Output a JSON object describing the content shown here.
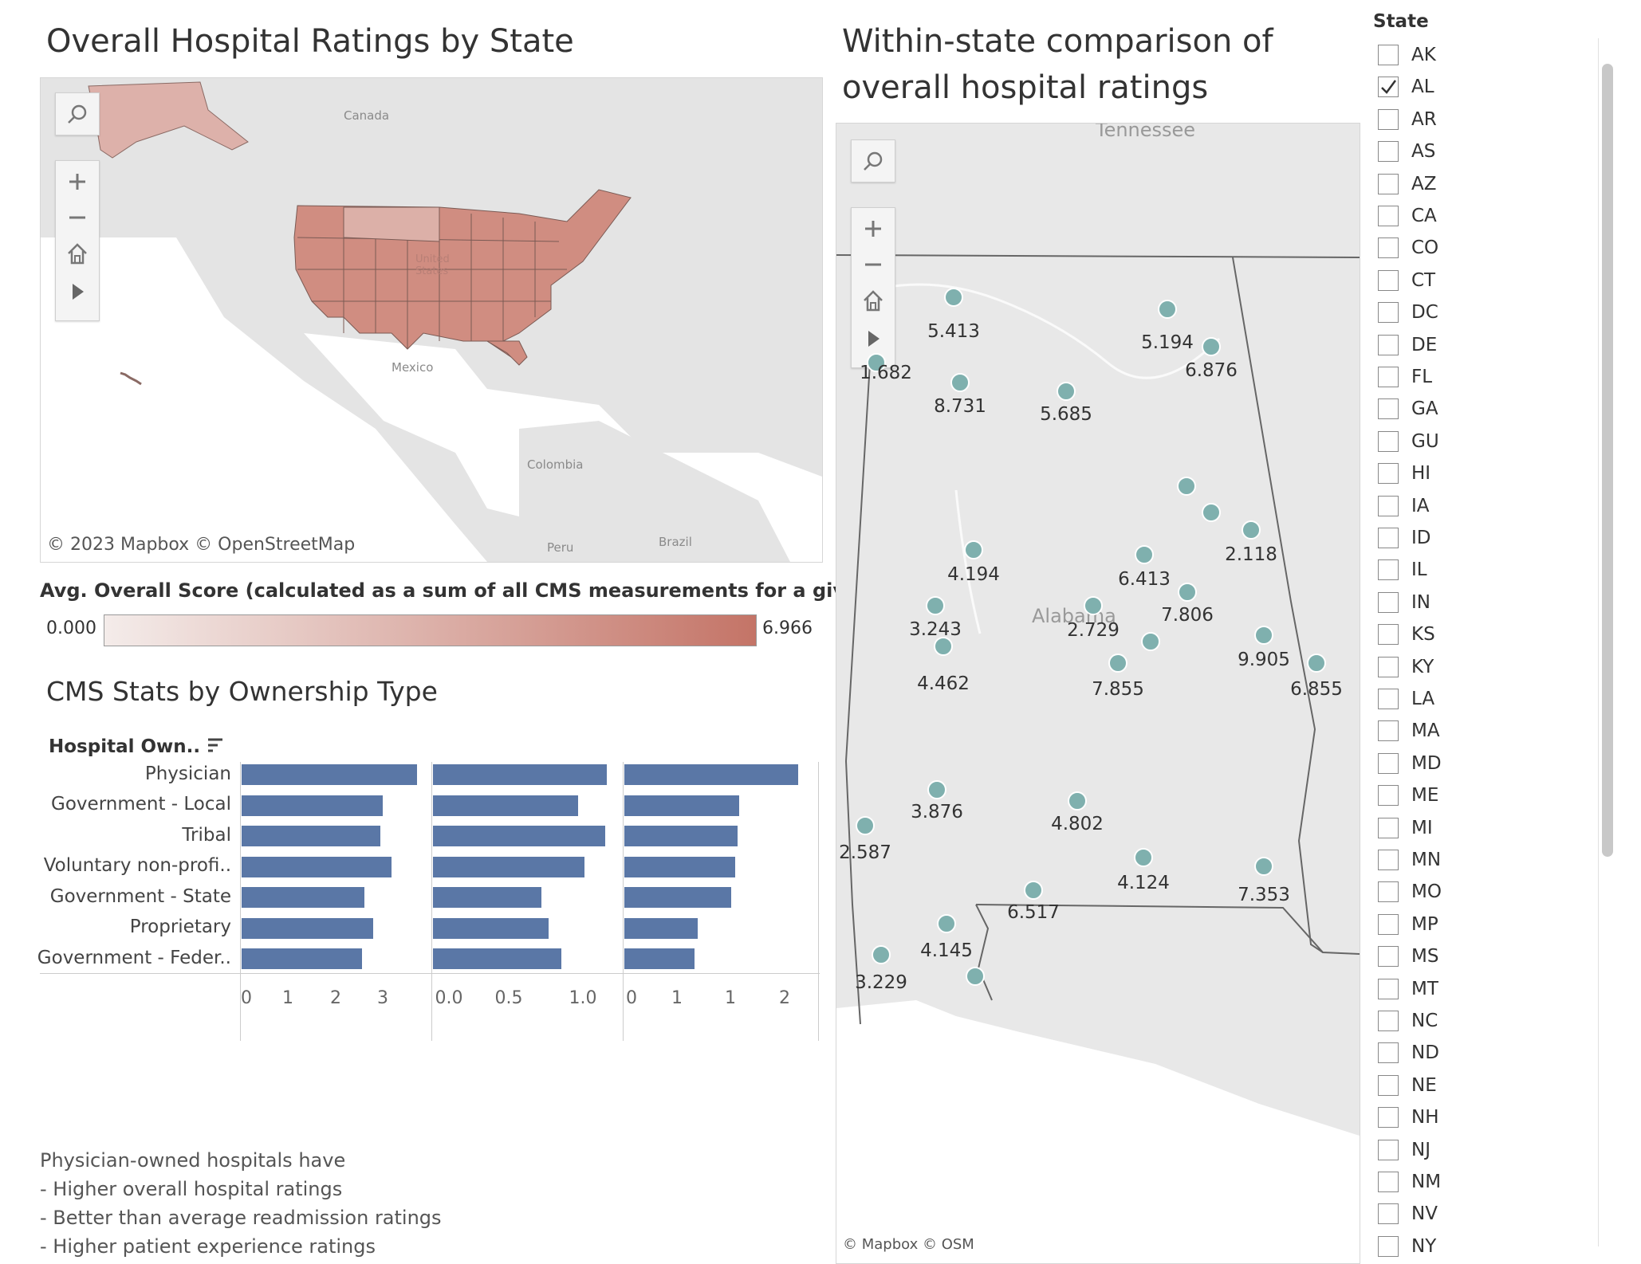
{
  "left_map": {
    "title": "Overall Hospital Ratings by State",
    "attribution": "© 2023 Mapbox  © OpenStreetMap",
    "places": [
      "Canada",
      "United States",
      "Mexico",
      "Colombia",
      "Peru",
      "Brazil"
    ]
  },
  "legend": {
    "title": "Avg. Overall Score (calculated as a sum of all CMS measurements for a given year)",
    "min": "0.000",
    "max": "6.966",
    "color_low": "#f4ecea",
    "color_high": "#c47467"
  },
  "ownership_chart": {
    "title": "CMS Stats by Ownership Type",
    "header": "Hospital Own..",
    "categories": [
      "Physician",
      "Government - Local",
      "Tribal",
      "Voluntary non-profi..",
      "Government - State",
      "Proprietary",
      "Government - Feder.."
    ],
    "panel1_ticks": [
      "0",
      "1",
      "2",
      "3"
    ],
    "panel2_ticks": [
      "0.0",
      "0.5",
      "1.0"
    ],
    "panel3_ticks": [
      "0",
      "1",
      "1",
      "2"
    ]
  },
  "chart_data": {
    "type": "bar",
    "categories": [
      "Physician",
      "Government - Local",
      "Tribal",
      "Voluntary non-profi..",
      "Government - State",
      "Proprietary",
      "Government - Feder.."
    ],
    "series": [
      {
        "values": [
          3.8,
          3.05,
          3.0,
          3.25,
          2.65,
          2.85,
          2.6
        ],
        "xlim": [
          0,
          3.9
        ]
      },
      {
        "values": [
          1.35,
          1.13,
          1.34,
          1.18,
          0.84,
          0.9,
          1.0
        ],
        "xlim": [
          0,
          1.4
        ]
      },
      {
        "values": [
          2.85,
          1.88,
          1.86,
          1.82,
          1.75,
          1.2,
          1.15
        ],
        "xlim": [
          0,
          2.95
        ]
      }
    ],
    "bar_color": "#5a77a6"
  },
  "notes": {
    "lines": [
      "Physician-owned hospitals have",
      "- Higher overall hospital ratings",
      "- Better than average readmission ratings",
      "- Higher patient experience ratings"
    ]
  },
  "right_map": {
    "title_line1": "Within-state comparison of",
    "title_line2": "overall hospital ratings",
    "attribution": "© Mapbox  © OSM",
    "place_top": "Tennessee",
    "place_center": "Alabama",
    "points": [
      {
        "label": "5.413"
      },
      {
        "label": "5.194"
      },
      {
        "label": "6.876"
      },
      {
        "label": "1.682"
      },
      {
        "label": "8.731"
      },
      {
        "label": "5.685"
      },
      {
        "label": "2.118"
      },
      {
        "label": "4.194"
      },
      {
        "label": "6.413"
      },
      {
        "label": "3.243"
      },
      {
        "label": "2.729"
      },
      {
        "label": "7.806"
      },
      {
        "label": "4.462"
      },
      {
        "label": "9.905"
      },
      {
        "label": "6.855"
      },
      {
        "label": "7.855"
      },
      {
        "label": "3.876"
      },
      {
        "label": "4.802"
      },
      {
        "label": "2.587"
      },
      {
        "label": "4.124"
      },
      {
        "label": "7.353"
      },
      {
        "label": "6.517"
      },
      {
        "label": "4.145"
      },
      {
        "label": "3.229"
      },
      {
        "label": ""
      },
      {
        "label": ""
      },
      {
        "label": ""
      },
      {
        "label": ""
      }
    ]
  },
  "state_filter": {
    "title": "State",
    "items": [
      {
        "label": "AK",
        "checked": false
      },
      {
        "label": "AL",
        "checked": true
      },
      {
        "label": "AR",
        "checked": false
      },
      {
        "label": "AS",
        "checked": false
      },
      {
        "label": "AZ",
        "checked": false
      },
      {
        "label": "CA",
        "checked": false
      },
      {
        "label": "CO",
        "checked": false
      },
      {
        "label": "CT",
        "checked": false
      },
      {
        "label": "DC",
        "checked": false
      },
      {
        "label": "DE",
        "checked": false
      },
      {
        "label": "FL",
        "checked": false
      },
      {
        "label": "GA",
        "checked": false
      },
      {
        "label": "GU",
        "checked": false
      },
      {
        "label": "HI",
        "checked": false
      },
      {
        "label": "IA",
        "checked": false
      },
      {
        "label": "ID",
        "checked": false
      },
      {
        "label": "IL",
        "checked": false
      },
      {
        "label": "IN",
        "checked": false
      },
      {
        "label": "KS",
        "checked": false
      },
      {
        "label": "KY",
        "checked": false
      },
      {
        "label": "LA",
        "checked": false
      },
      {
        "label": "MA",
        "checked": false
      },
      {
        "label": "MD",
        "checked": false
      },
      {
        "label": "ME",
        "checked": false
      },
      {
        "label": "MI",
        "checked": false
      },
      {
        "label": "MN",
        "checked": false
      },
      {
        "label": "MO",
        "checked": false
      },
      {
        "label": "MP",
        "checked": false
      },
      {
        "label": "MS",
        "checked": false
      },
      {
        "label": "MT",
        "checked": false
      },
      {
        "label": "NC",
        "checked": false
      },
      {
        "label": "ND",
        "checked": false
      },
      {
        "label": "NE",
        "checked": false
      },
      {
        "label": "NH",
        "checked": false
      },
      {
        "label": "NJ",
        "checked": false
      },
      {
        "label": "NM",
        "checked": false
      },
      {
        "label": "NV",
        "checked": false
      },
      {
        "label": "NY",
        "checked": false
      }
    ]
  }
}
